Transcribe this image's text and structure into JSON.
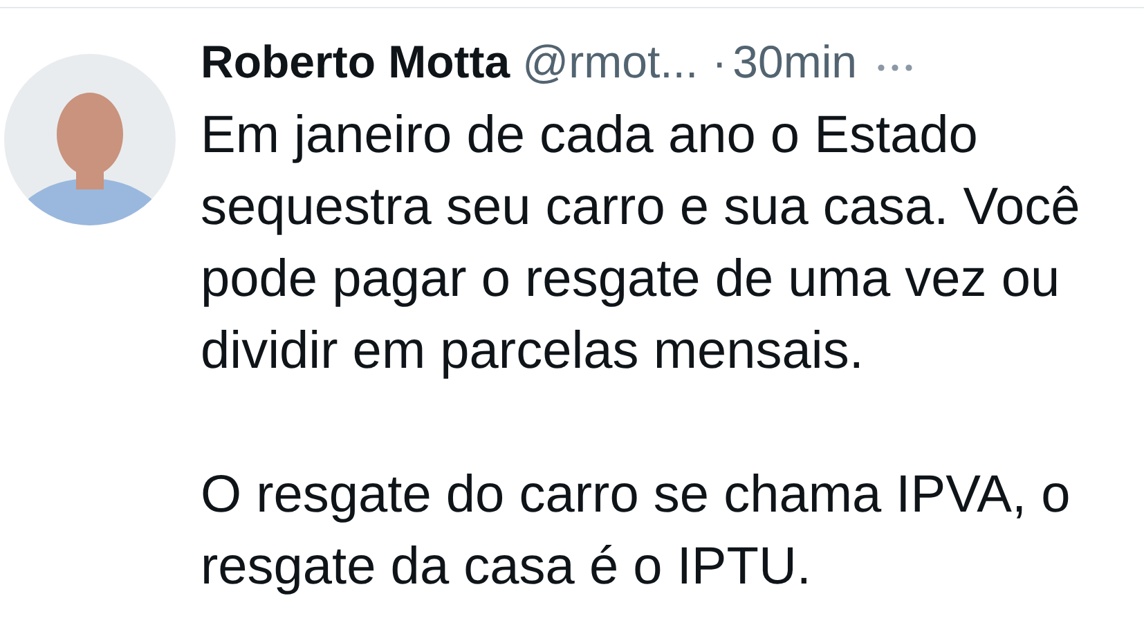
{
  "tweet": {
    "author": {
      "name": "Roberto Motta",
      "handle": "@rmot...",
      "separator": "·",
      "time": "30min"
    },
    "paragraphs": [
      "Em janeiro de cada ano o Estado sequestra seu carro e sua casa. Você pode pagar o resgate de uma vez ou dividir em parcelas mensais.",
      "O resgate do carro se chama IPVA, o resgate da casa é o IPTU."
    ]
  }
}
